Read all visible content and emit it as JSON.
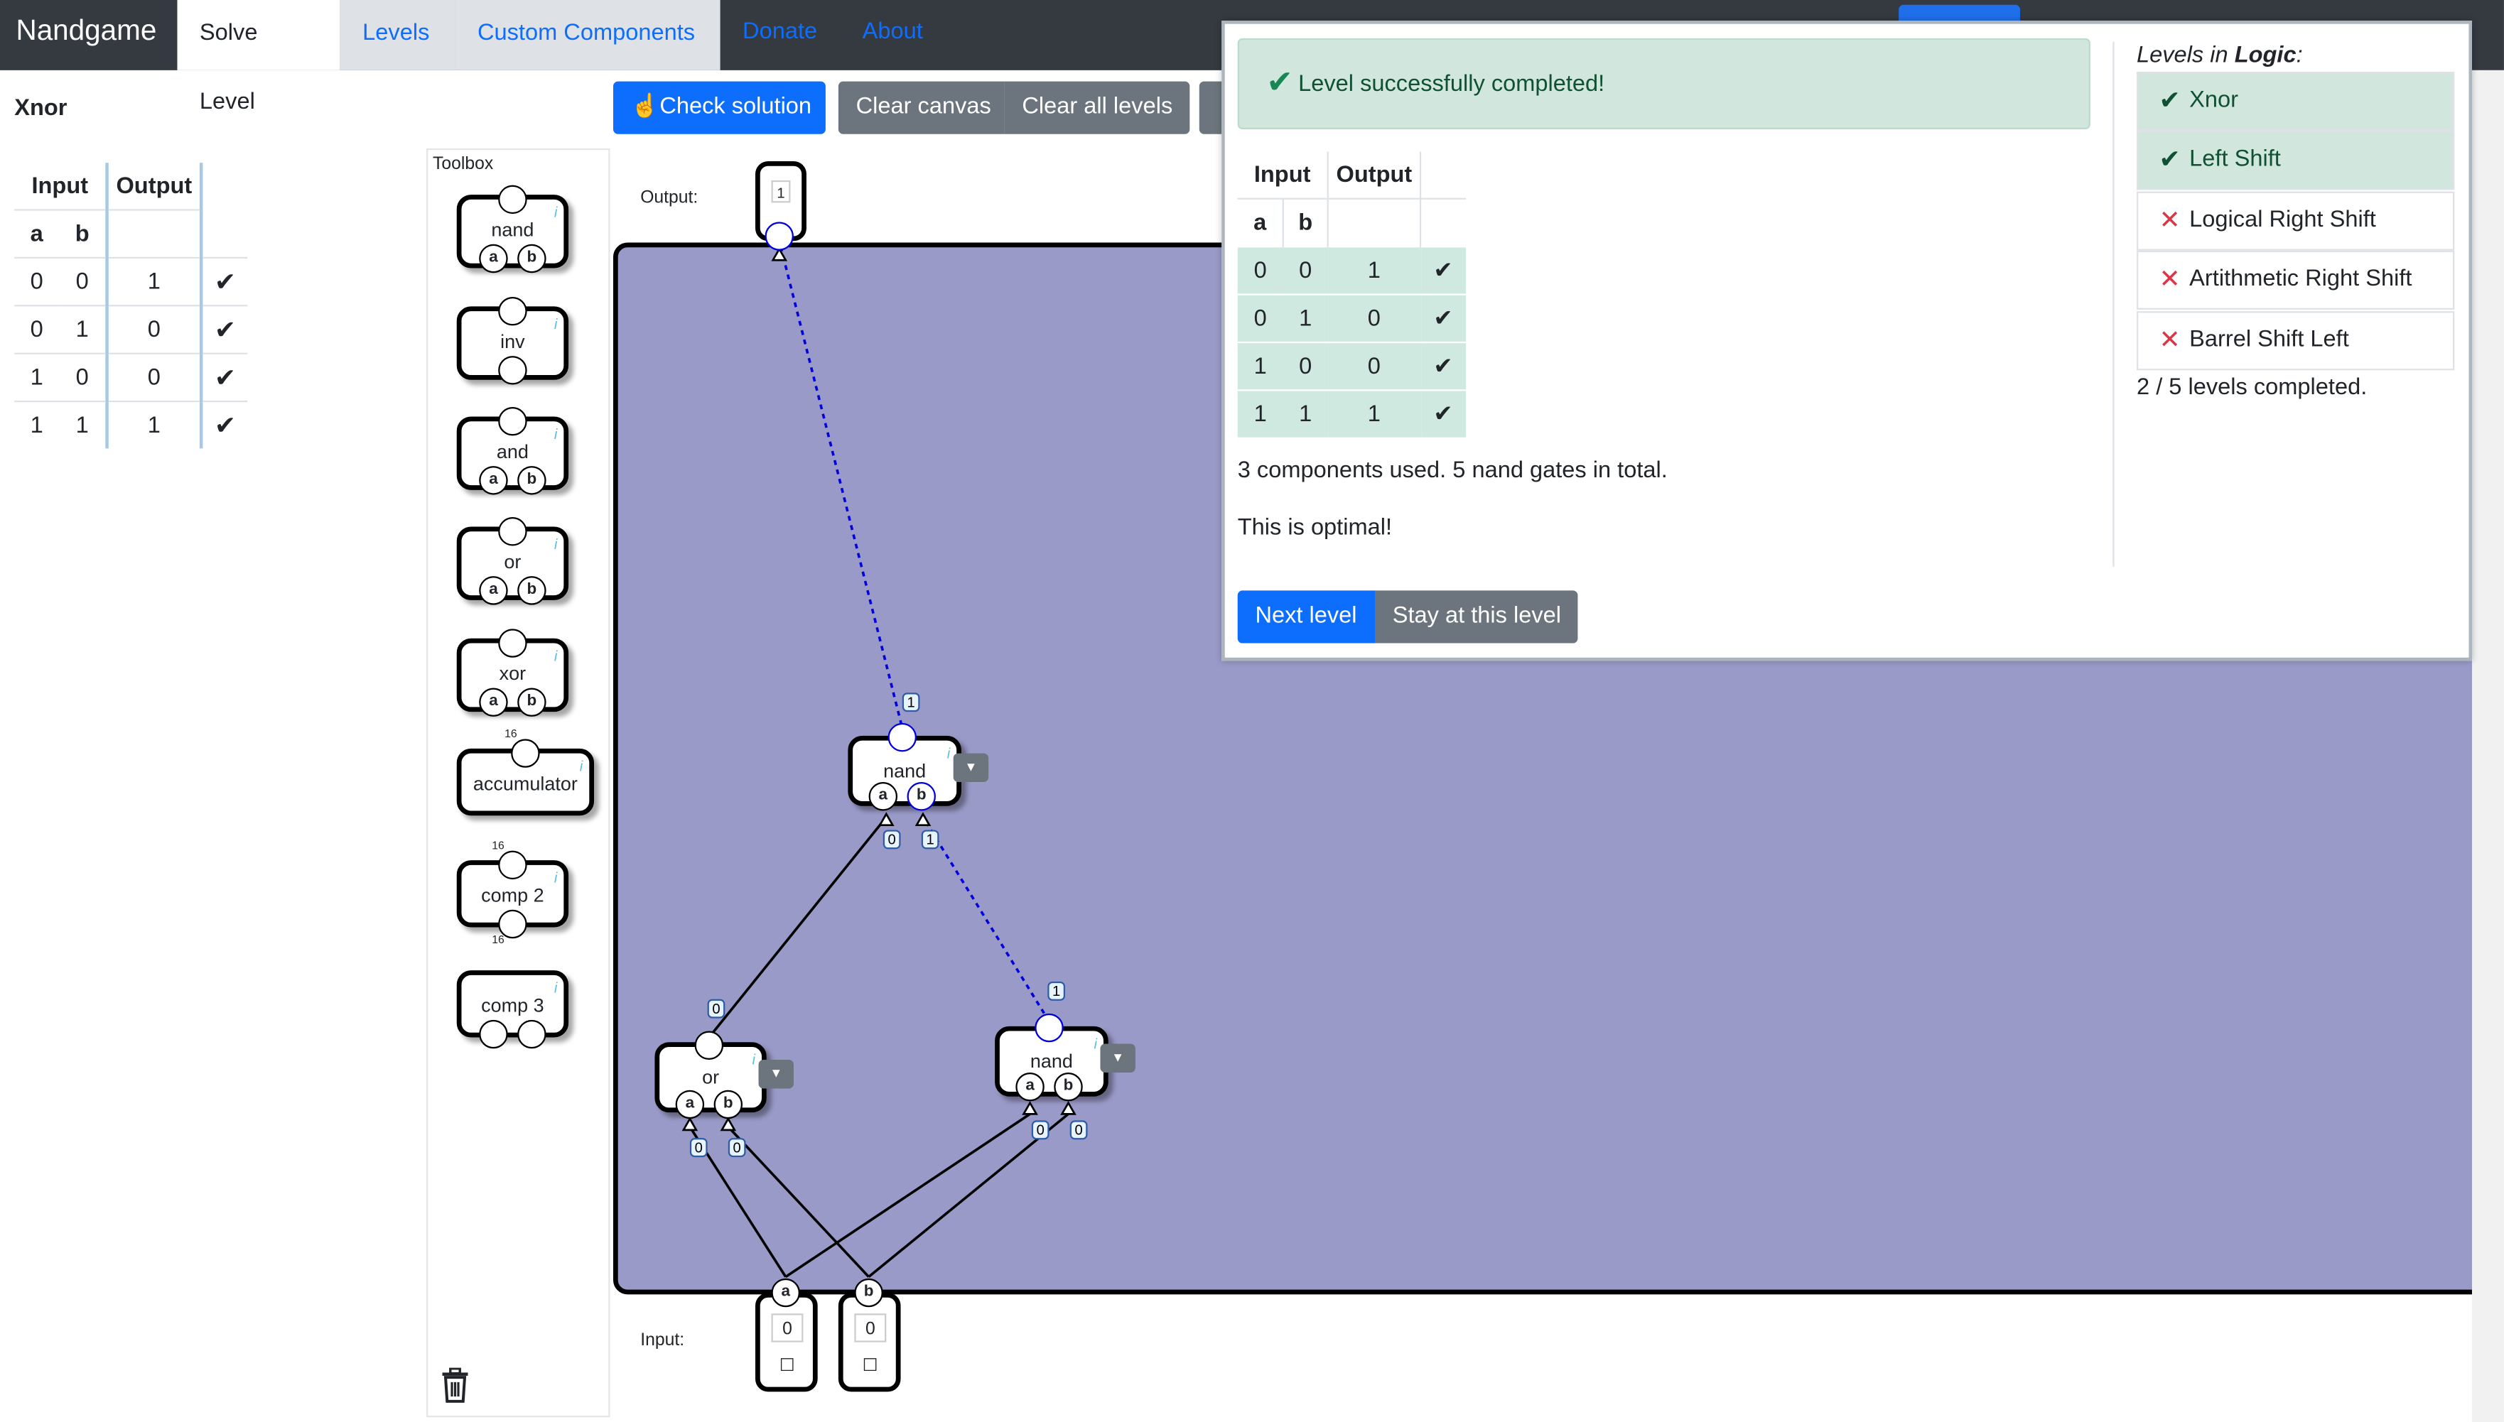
{
  "navbar": {
    "brand": "Nandgame",
    "tabs": [
      "Solve Level",
      "Levels",
      "Custom Components"
    ],
    "links": [
      "Donate",
      "About"
    ]
  },
  "level": {
    "name": "Xnor",
    "table": {
      "headers": [
        "Input",
        "Output"
      ],
      "subheaders": [
        "a",
        "b"
      ],
      "rows": [
        {
          "a": "0",
          "b": "0",
          "out": "1",
          "status": "✔"
        },
        {
          "a": "0",
          "b": "1",
          "out": "0",
          "status": "✔"
        },
        {
          "a": "1",
          "b": "0",
          "out": "0",
          "status": "✔"
        },
        {
          "a": "1",
          "b": "1",
          "out": "1",
          "status": "✔"
        }
      ]
    }
  },
  "toolbar": {
    "check": "Check solution",
    "clear_canvas": "Clear canvas",
    "clear_all": "Clear all levels"
  },
  "toolbox": {
    "title": "Toolbox",
    "items": [
      "nand",
      "inv",
      "and",
      "or",
      "xor",
      "accumulator",
      "comp 2",
      "comp 3"
    ],
    "bit_width": "16",
    "info_glyph": "i"
  },
  "canvas": {
    "output_label": "Output:",
    "input_label": "Input:",
    "output_value": "1",
    "input_a": {
      "pin": "a",
      "value": "0",
      "checkbox": "☐"
    },
    "input_b": {
      "pin": "b",
      "value": "0",
      "checkbox": "☐"
    },
    "gates": [
      {
        "type": "nand",
        "pins": [
          "a",
          "b"
        ]
      },
      {
        "type": "or",
        "pins": [
          "a",
          "b"
        ]
      },
      {
        "type": "nand",
        "pins": [
          "a",
          "b"
        ]
      }
    ],
    "wire_values": {
      "top_nand_out": "1",
      "top_nand_a": "0",
      "top_nand_b": "1",
      "or_out": "0",
      "nand2_out": "1",
      "or_a": "0",
      "or_b": "0",
      "nand2_a": "0",
      "nand2_b": "0"
    },
    "active_color": "#0000dd"
  },
  "modal": {
    "success": "Level successfully completed!",
    "table": {
      "headers": [
        "Input",
        "Output"
      ],
      "subheaders": [
        "a",
        "b"
      ],
      "rows": [
        {
          "a": "0",
          "b": "0",
          "out": "1",
          "status": "✔"
        },
        {
          "a": "0",
          "b": "1",
          "out": "0",
          "status": "✔"
        },
        {
          "a": "1",
          "b": "0",
          "out": "0",
          "status": "✔"
        },
        {
          "a": "1",
          "b": "1",
          "out": "1",
          "status": "✔"
        }
      ]
    },
    "stats": "3 components used. 5 nand gates in total.",
    "optimal": "This is optimal!",
    "next": "Next level",
    "stay": "Stay at this level",
    "levels_heading_prefix": "Levels in ",
    "levels_heading_group": "Logic",
    "levels_heading_suffix": ":",
    "levels": [
      {
        "name": "Xnor",
        "done": true
      },
      {
        "name": "Left Shift",
        "done": true
      },
      {
        "name": "Logical Right Shift",
        "done": false
      },
      {
        "name": "Artithmetic Right Shift",
        "done": false
      },
      {
        "name": "Barrel Shift Left",
        "done": false
      }
    ],
    "progress": "2 / 5 levels completed."
  },
  "colors": {
    "navbar": "#343a40",
    "primary": "#0d6efd",
    "secondary": "#6c757d",
    "canvas": "#9a9ac8",
    "success_bg": "#d1e7dd",
    "fail": "#dc3545"
  }
}
